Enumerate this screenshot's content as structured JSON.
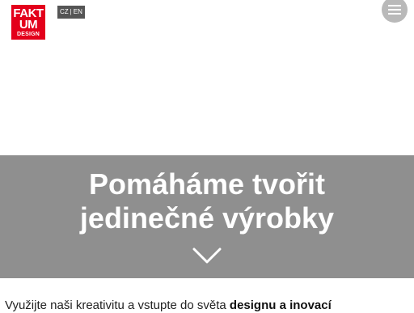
{
  "header": {
    "logo": {
      "line1": "FAKT",
      "line2": "UM",
      "line3": "DESIGN",
      "color": "#e3001b"
    },
    "language": {
      "cz": "CZ",
      "separator": "|",
      "en": "EN"
    },
    "menu_icon": "hamburger-menu-icon"
  },
  "hero": {
    "title_line1": "Pomáháme tvořit",
    "title_line2": "jedinečné výrobky",
    "scroll_icon": "chevron-down-icon",
    "background": "#8f8f8f"
  },
  "intro": {
    "text": "Využijte naši kreativitu a vstupte do světa ",
    "bold": "designu a inovací"
  }
}
